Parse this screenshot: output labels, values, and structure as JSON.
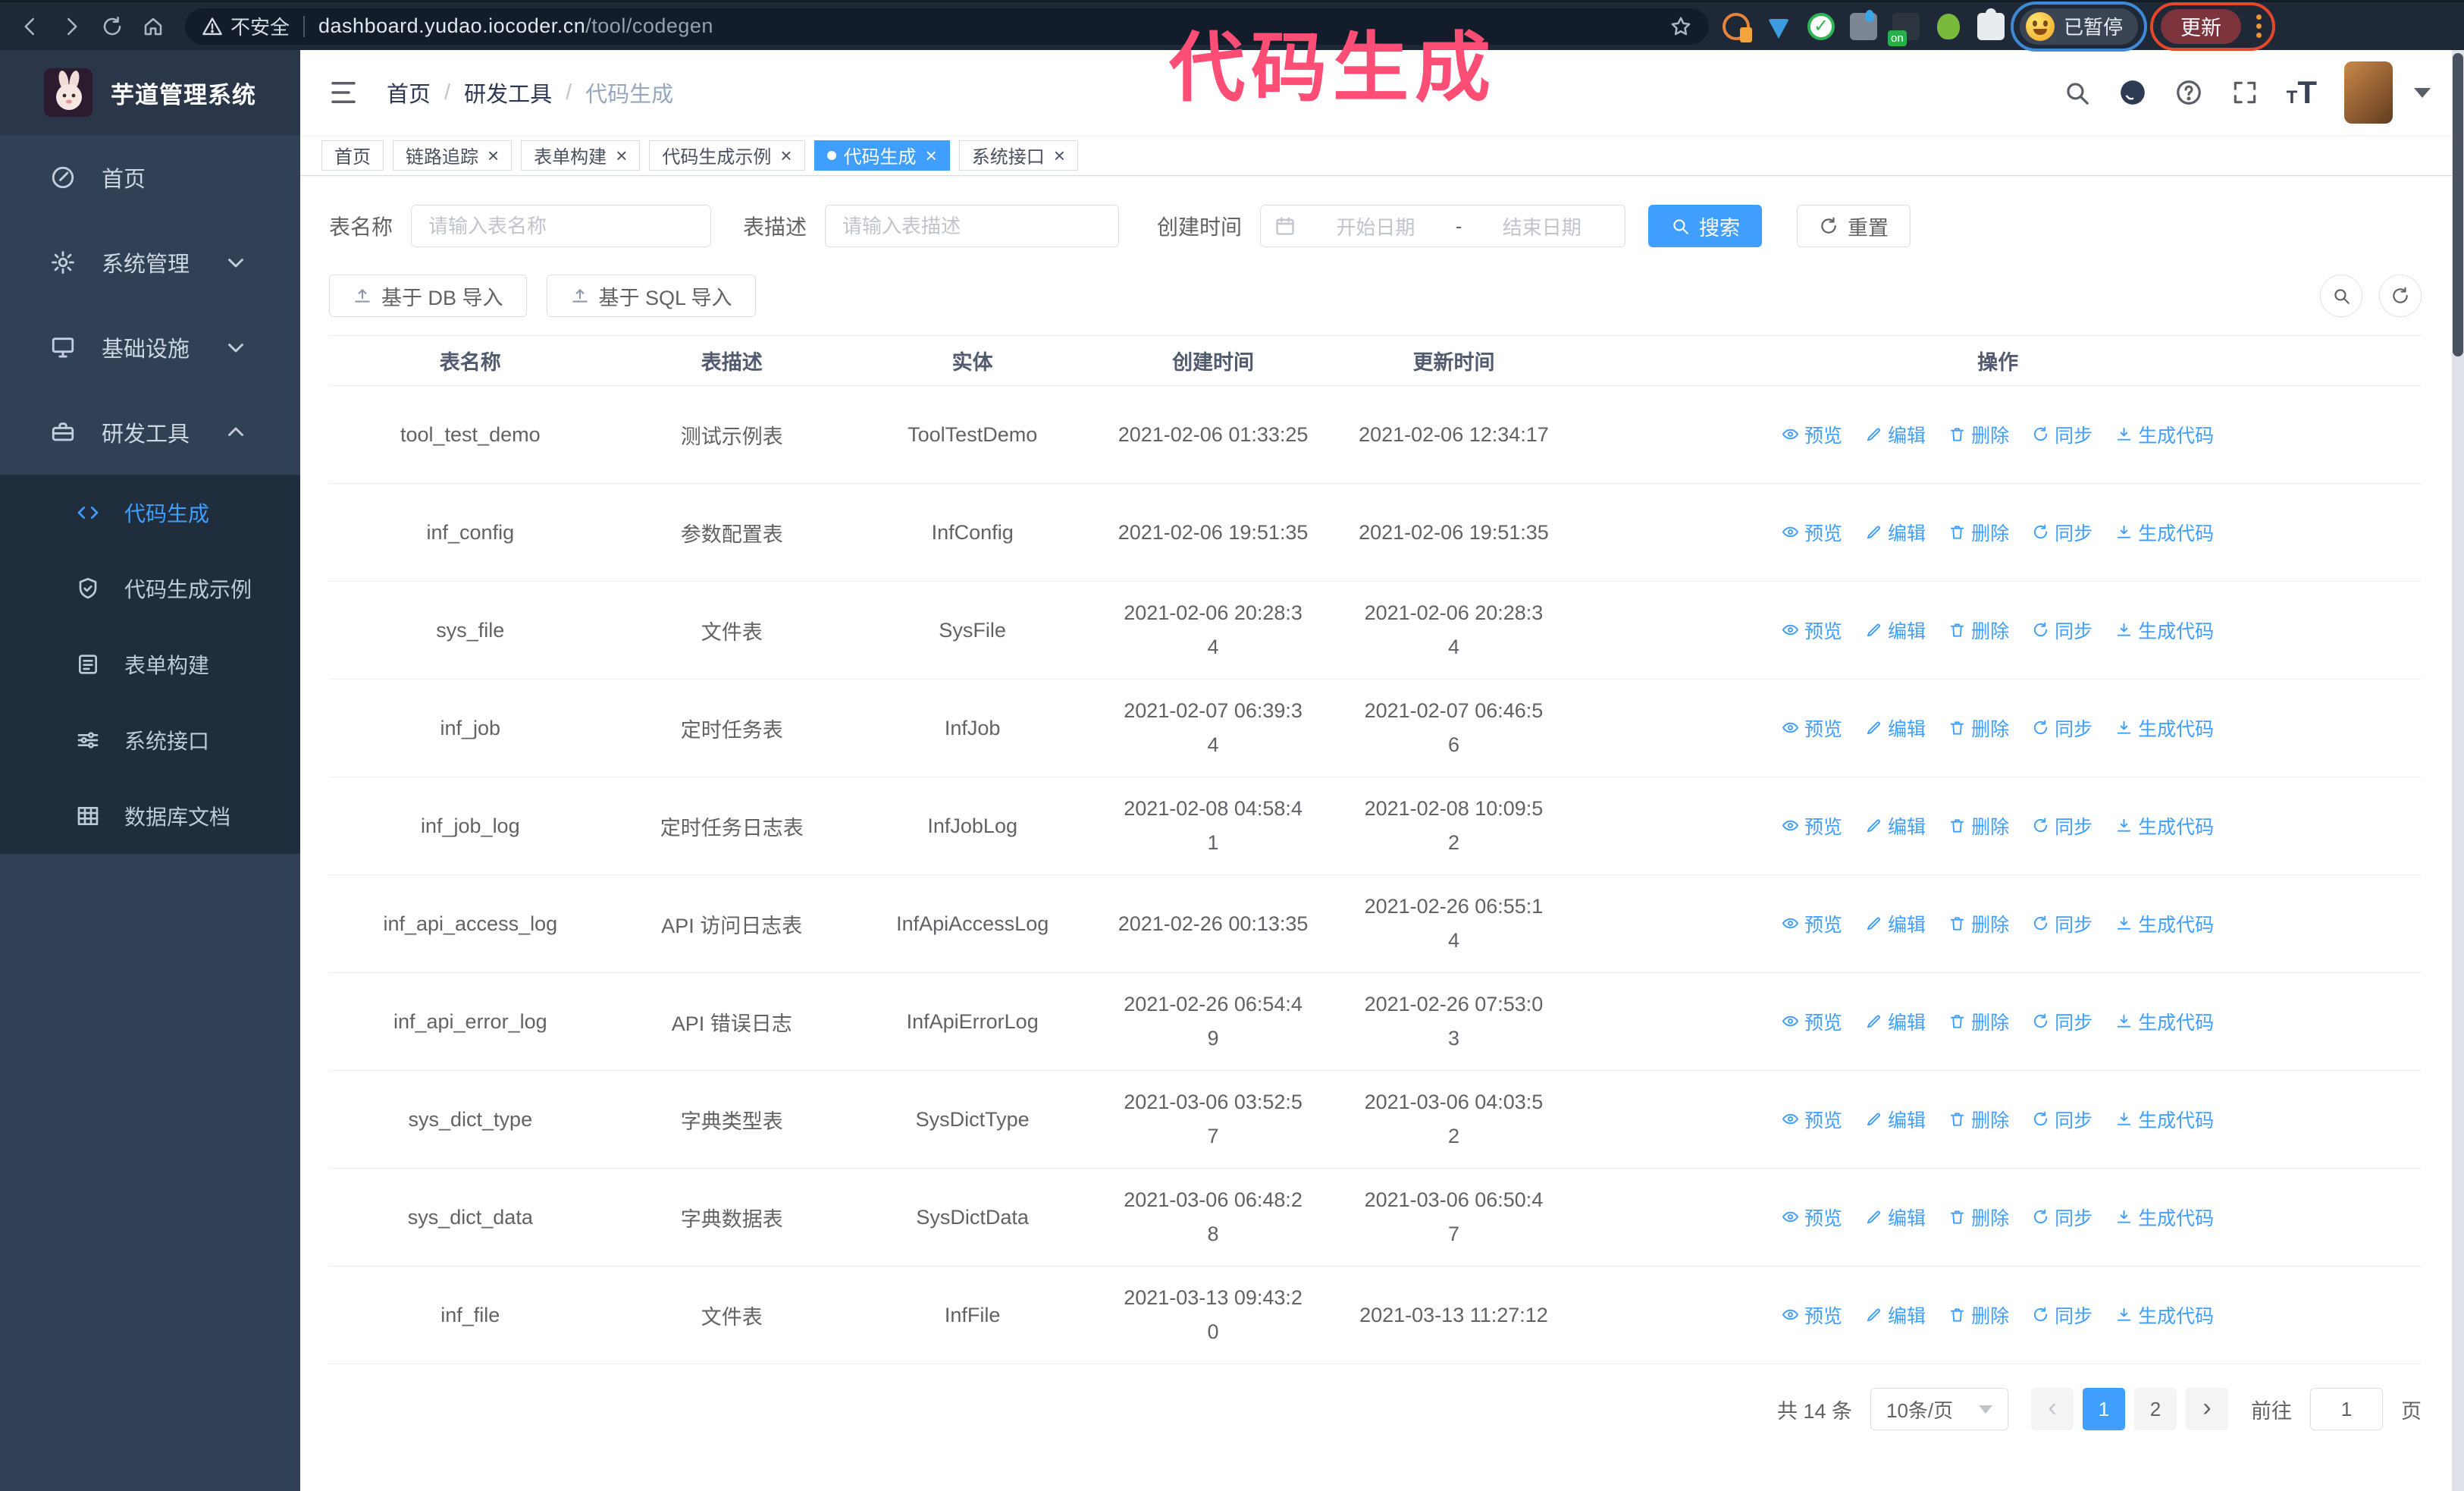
{
  "colors": {
    "accent": "#409eff",
    "annotation_pink": "#ff4e75",
    "sidebar_bg": "#304156",
    "submenu_bg": "#1f2d3d"
  },
  "annotation": {
    "title": "代码生成"
  },
  "browser": {
    "security_warning": "不安全",
    "url_domain": "dashboard.yudao.iocoder.cn",
    "url_path": "/tool/codegen",
    "paused_badge": "已暂停",
    "update_button": "更新"
  },
  "sidebar": {
    "app_title": "芋道管理系统",
    "items": [
      {
        "key": "home",
        "label": "首页",
        "icon": "dashboard-icon",
        "expandable": false,
        "expanded": false
      },
      {
        "key": "system",
        "label": "系统管理",
        "icon": "gear-icon",
        "expandable": true,
        "expanded": false
      },
      {
        "key": "infra",
        "label": "基础设施",
        "icon": "monitor-icon",
        "expandable": true,
        "expanded": false
      },
      {
        "key": "devtools",
        "label": "研发工具",
        "icon": "toolbox-icon",
        "expandable": true,
        "expanded": true
      }
    ],
    "submenu": [
      {
        "key": "codegen",
        "label": "代码生成",
        "icon": "code-icon",
        "active": true
      },
      {
        "key": "codegen-example",
        "label": "代码生成示例",
        "icon": "shield-check-icon",
        "active": false
      },
      {
        "key": "form-builder",
        "label": "表单构建",
        "icon": "form-icon",
        "active": false
      },
      {
        "key": "system-api",
        "label": "系统接口",
        "icon": "sliders-icon",
        "active": false
      },
      {
        "key": "db-doc",
        "label": "数据库文档",
        "icon": "db-table-icon",
        "active": false
      }
    ]
  },
  "header": {
    "breadcrumb": [
      "首页",
      "研发工具",
      "代码生成"
    ]
  },
  "tabs": [
    {
      "label": "首页",
      "closable": false,
      "active": false
    },
    {
      "label": "链路追踪",
      "closable": true,
      "active": false
    },
    {
      "label": "表单构建",
      "closable": true,
      "active": false
    },
    {
      "label": "代码生成示例",
      "closable": true,
      "active": false
    },
    {
      "label": "代码生成",
      "closable": true,
      "active": true
    },
    {
      "label": "系统接口",
      "closable": true,
      "active": false
    }
  ],
  "filters": {
    "table_name_label": "表名称",
    "table_name_placeholder": "请输入表名称",
    "table_desc_label": "表描述",
    "table_desc_placeholder": "请输入表描述",
    "create_time_label": "创建时间",
    "date_start_placeholder": "开始日期",
    "date_separator": "-",
    "date_end_placeholder": "结束日期",
    "search_label": "搜索",
    "reset_label": "重置"
  },
  "toolbar": {
    "import_db_label": "基于 DB 导入",
    "import_sql_label": "基于 SQL 导入"
  },
  "table": {
    "columns": [
      "表名称",
      "表描述",
      "实体",
      "创建时间",
      "更新时间",
      "操作"
    ],
    "actions": {
      "preview": "预览",
      "edit": "编辑",
      "delete": "删除",
      "sync": "同步",
      "generate": "生成代码"
    },
    "rows": [
      {
        "name": "tool_test_demo",
        "desc": "测试示例表",
        "entity": "ToolTestDemo",
        "created": "2021-02-06 01:33:25",
        "updated": "2021-02-06 12:34:17"
      },
      {
        "name": "inf_config",
        "desc": "参数配置表",
        "entity": "InfConfig",
        "created": "2021-02-06 19:51:35",
        "updated": "2021-02-06 19:51:35"
      },
      {
        "name": "sys_file",
        "desc": "文件表",
        "entity": "SysFile",
        "created": "2021-02-06 20:28:3\n4",
        "updated": "2021-02-06 20:28:3\n4"
      },
      {
        "name": "inf_job",
        "desc": "定时任务表",
        "entity": "InfJob",
        "created": "2021-02-07 06:39:3\n4",
        "updated": "2021-02-07 06:46:5\n6"
      },
      {
        "name": "inf_job_log",
        "desc": "定时任务日志表",
        "entity": "InfJobLog",
        "created": "2021-02-08 04:58:4\n1",
        "updated": "2021-02-08 10:09:5\n2"
      },
      {
        "name": "inf_api_access_log",
        "desc": "API 访问日志表",
        "entity": "InfApiAccessLog",
        "created": "2021-02-26 00:13:35",
        "updated": "2021-02-26 06:55:1\n4"
      },
      {
        "name": "inf_api_error_log",
        "desc": "API 错误日志",
        "entity": "InfApiErrorLog",
        "created": "2021-02-26 06:54:4\n9",
        "updated": "2021-02-26 07:53:0\n3"
      },
      {
        "name": "sys_dict_type",
        "desc": "字典类型表",
        "entity": "SysDictType",
        "created": "2021-03-06 03:52:5\n7",
        "updated": "2021-03-06 04:03:5\n2"
      },
      {
        "name": "sys_dict_data",
        "desc": "字典数据表",
        "entity": "SysDictData",
        "created": "2021-03-06 06:48:2\n8",
        "updated": "2021-03-06 06:50:4\n7"
      },
      {
        "name": "inf_file",
        "desc": "文件表",
        "entity": "InfFile",
        "created": "2021-03-13 09:43:2\n0",
        "updated": "2021-03-13 11:27:12"
      }
    ]
  },
  "pagination": {
    "total": "共 14 条",
    "page_size": "10条/页",
    "pages": [
      "1",
      "2"
    ],
    "active_page": "1",
    "goto_label": "前往",
    "goto_value": "1",
    "page_unit": "页"
  }
}
